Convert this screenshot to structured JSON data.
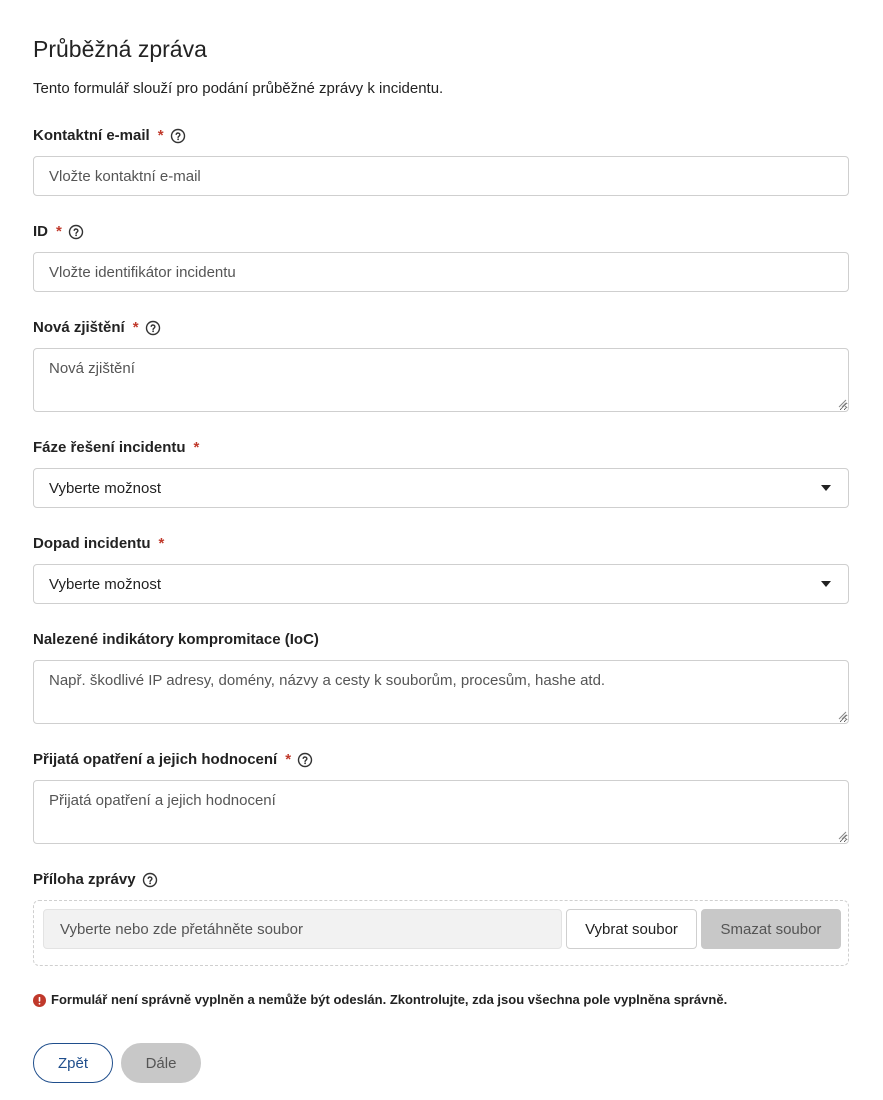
{
  "form": {
    "title": "Průběžná zpráva",
    "description": "Tento formulář slouží pro podání průběžné zprávy k incidentu.",
    "required_mark": "*",
    "fields": {
      "email": {
        "label": "Kontaktní e-mail",
        "placeholder": "Vložte kontaktní e-mail",
        "value": ""
      },
      "id": {
        "label": "ID",
        "placeholder": "Vložte identifikátor incidentu",
        "value": ""
      },
      "findings": {
        "label": "Nová zjištění",
        "placeholder": "Nová zjištění",
        "value": ""
      },
      "phase": {
        "label": "Fáze řešení incidentu",
        "selected": "Vyberte možnost"
      },
      "impact": {
        "label": "Dopad incidentu",
        "selected": "Vyberte možnost"
      },
      "ioc": {
        "label": "Nalezené indikátory kompromitace (IoC)",
        "placeholder": "Např. škodlivé IP adresy, domény, názvy a cesty k souborům, procesům, hashe atd.",
        "value": ""
      },
      "measures": {
        "label": "Přijatá opatření a jejich hodnocení",
        "placeholder": "Přijatá opatření a jejich hodnocení",
        "value": ""
      },
      "attachment": {
        "label": "Příloha zprávy",
        "dropzone_text": "Vyberte nebo zde přetáhněte soubor",
        "choose_label": "Vybrat soubor",
        "clear_label": "Smazat soubor"
      }
    },
    "error_message": "Formulář není správně vyplněn a nemůže být odeslán. Zkontrolujte, zda jsou všechna pole vyplněna správně.",
    "buttons": {
      "back": "Zpět",
      "next": "Dále"
    }
  },
  "icons": {
    "help": "question-circle-icon",
    "error": "exclamation-circle-icon",
    "caret": "caret-down-icon"
  },
  "colors": {
    "required": "#c0392b",
    "primary": "#1f4e8c",
    "disabled_bg": "#c8c8c8",
    "error_icon": "#c0392b"
  }
}
